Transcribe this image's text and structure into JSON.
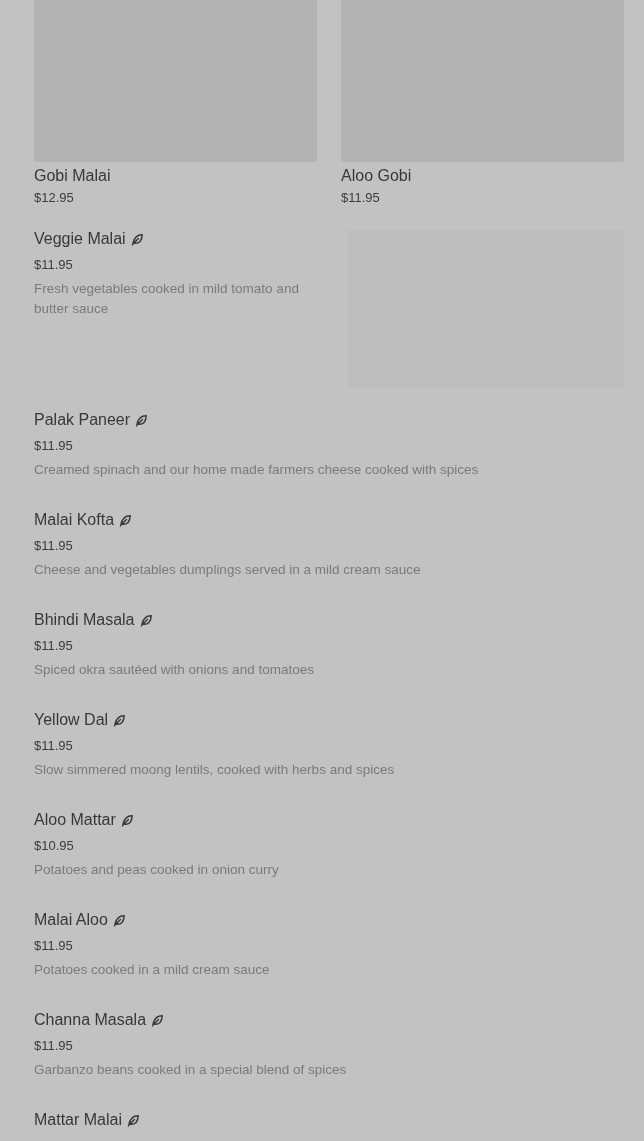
{
  "grid_items": [
    {
      "name": "Gobi Malai",
      "price": "$12.95"
    },
    {
      "name": "Aloo Gobi",
      "price": "$11.95"
    }
  ],
  "featured": {
    "name": "Veggie Malai",
    "vegetarian": true,
    "price": "$11.95",
    "description": "Fresh vegetables cooked in mild tomato and butter sauce"
  },
  "items": [
    {
      "name": "Palak Paneer",
      "vegetarian": true,
      "price": "$11.95",
      "description": "Creamed spinach and our home made farmers cheese cooked with spices"
    },
    {
      "name": "Malai Kofta",
      "vegetarian": true,
      "price": "$11.95",
      "description": "Cheese and vegetables dumplings served in a mild cream sauce"
    },
    {
      "name": "Bhindi Masala",
      "vegetarian": true,
      "price": "$11.95",
      "description": "Spiced okra sautéed with onions and tomatoes"
    },
    {
      "name": "Yellow Dal",
      "vegetarian": true,
      "price": "$11.95",
      "description": "Slow simmered moong lentils, cooked with herbs and spices"
    },
    {
      "name": "Aloo Mattar",
      "vegetarian": true,
      "price": "$10.95",
      "description": "Potatoes and peas cooked in onion curry"
    },
    {
      "name": "Malai Aloo",
      "vegetarian": true,
      "price": "$11.95",
      "description": "Potatoes cooked in a mild cream sauce"
    },
    {
      "name": "Channa Masala",
      "vegetarian": true,
      "price": "$11.95",
      "description": "Garbanzo beans cooked in a special blend of spices"
    },
    {
      "name": "Mattar Malai",
      "vegetarian": true
    }
  ]
}
